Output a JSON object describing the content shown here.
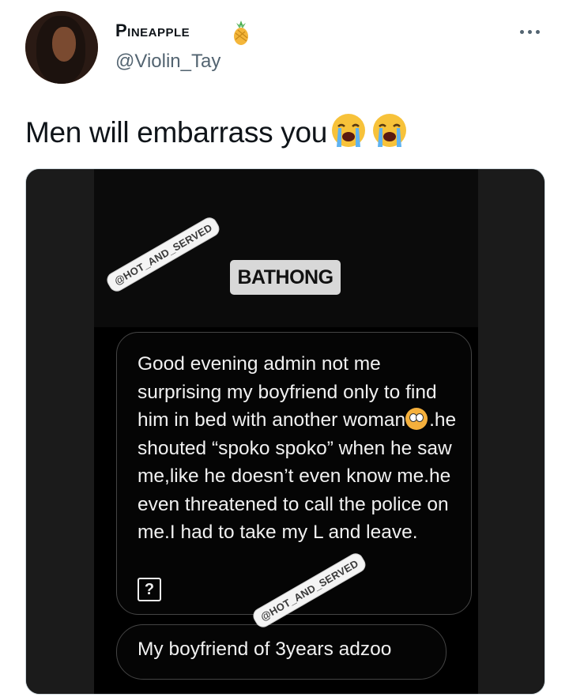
{
  "author": {
    "display_name": "Pineapple",
    "handle": "@Violin_Tay"
  },
  "tweet": {
    "text": "Men will embarrass you"
  },
  "media": {
    "watermark_top": "@HOT_AND_SERVED",
    "watermark_bottom": "@HOT_AND_SERVED",
    "badge_label": "BATHONG",
    "message_1": "Good evening admin not me surprising my boyfriend only to find him in bed with another woman",
    "message_1_cont": ".he shouted “spoko spoko” when he saw me,like he doesn’t even know me.he even threatened to call the police on me.I had to take my L and leave.",
    "question_mark": "?",
    "message_2": "My boyfriend of 3years adzoo"
  },
  "icons": {
    "verified_emoji": "pineapple-icon",
    "tweet_emoji": "loudly-crying-face-icon",
    "inline_emoji": "astonished-face-icon",
    "menu": "more-options-icon"
  }
}
